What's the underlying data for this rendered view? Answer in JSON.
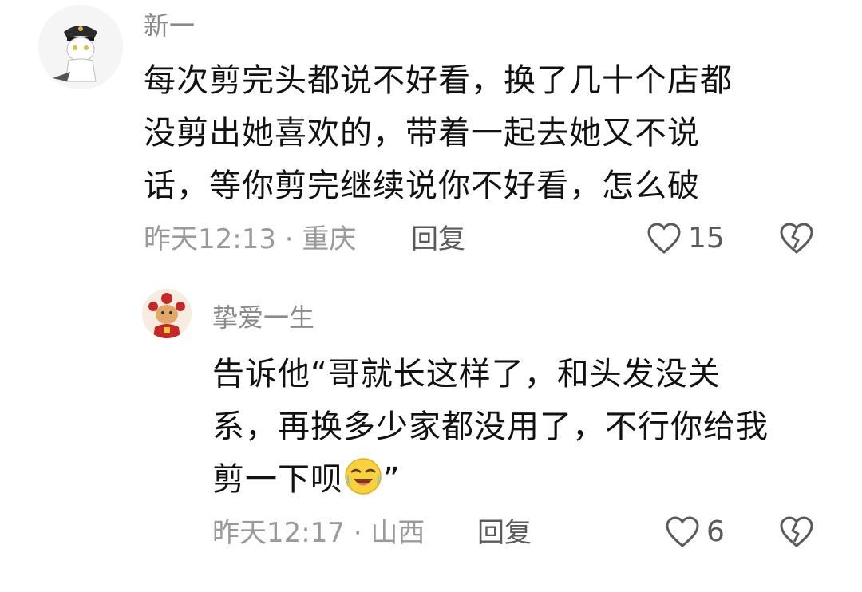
{
  "comments": [
    {
      "username": "新一",
      "lines": [
        "每次剪完头都说不好看，换了几十个店都",
        "没剪出她喜欢的，带着一起去她又不说",
        "话，等你剪完继续说你不好看，怎么破"
      ],
      "meta": "昨天12:13 · 重庆",
      "reply_label": "回复",
      "likes": "15",
      "avatar_icon": "cat-avatar-icon"
    },
    {
      "username": "挚爱一生",
      "lines": [
        "告诉他“哥就长这样了，和头发没关",
        "系，再换多少家都没用了，不行你给我",
        "剪一下呗"
      ],
      "line3_suffix": "”",
      "emoji": "crying-laughing-emoji",
      "meta": "昨天12:17 · 山西",
      "reply_label": "回复",
      "likes": "6",
      "avatar_icon": "fortune-cat-avatar-icon"
    }
  ],
  "colors": {
    "text": "#111111",
    "username": "#8a8a8a",
    "meta": "#9a9a9a",
    "action": "#5a5a5a"
  }
}
